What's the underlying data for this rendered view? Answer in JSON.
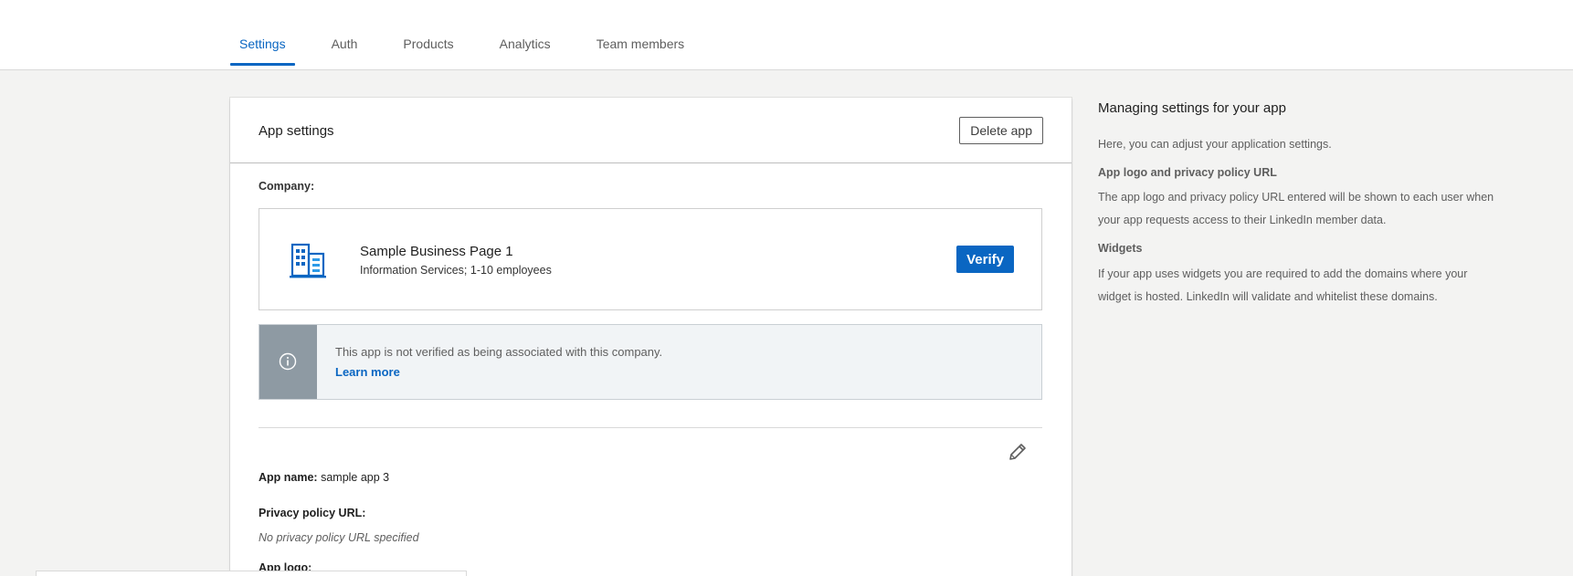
{
  "tabs": [
    {
      "label": "Settings",
      "active": true
    },
    {
      "label": "Auth"
    },
    {
      "label": "Products"
    },
    {
      "label": "Analytics"
    },
    {
      "label": "Team members"
    }
  ],
  "card": {
    "title": "App settings",
    "delete_label": "Delete app",
    "company_label": "Company:",
    "company": {
      "name": "Sample Business Page 1",
      "description": "Information Services; 1-10 employees",
      "icon": "building-icon",
      "verify_label": "Verify"
    },
    "alert": {
      "icon": "info-icon",
      "text": "This app is not verified as being associated with this company.",
      "link": "Learn more"
    },
    "fields": {
      "app_name_label": "App name:",
      "app_name_value": "sample app 3",
      "privacy_label": "Privacy policy URL:",
      "privacy_value": "No privacy policy URL specified",
      "logo_label": "App logo:"
    }
  },
  "help": {
    "title": "Managing settings for your app",
    "intro": "Here, you can adjust your application settings.",
    "logo_heading": "App logo and privacy policy URL",
    "logo_text": "The app logo and privacy policy URL entered will be shown to each user when your app requests access to their LinkedIn member data.",
    "widgets_heading": "Widgets",
    "widgets_text": "If your app uses widgets you are required to add the domains where your widget is hosted. LinkedIn will validate and whitelist these domains."
  },
  "colors": {
    "accent": "#0a66c2",
    "background": "#f3f3f2",
    "alert_side": "#8e9aa3"
  }
}
